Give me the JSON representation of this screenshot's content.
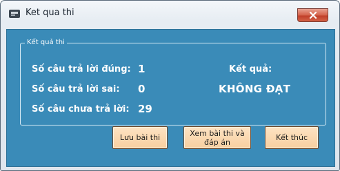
{
  "window": {
    "title": "Ket qua thi"
  },
  "group": {
    "legend": "Kết quả thi"
  },
  "stats": [
    {
      "label": "Số câu trả lời đúng:",
      "value": "1"
    },
    {
      "label": "Số câu trả lời sai:",
      "value": "0"
    },
    {
      "label": "Số câu chưa trả lời:",
      "value": "29"
    }
  ],
  "result": {
    "label": "Kết quả:",
    "value": "KHÔNG ĐẠT"
  },
  "buttons": {
    "save_label": "Lưu bài thi",
    "review_line1": "Xem bài thi và",
    "review_line2": "đáp án",
    "finish_label": "Kết thúc"
  },
  "colors": {
    "client_background": "#3a8bb8",
    "button_background": "#f8cfa0",
    "text": "#ffffff"
  },
  "icons": {
    "app": "app-window-icon",
    "close": "close-icon"
  }
}
